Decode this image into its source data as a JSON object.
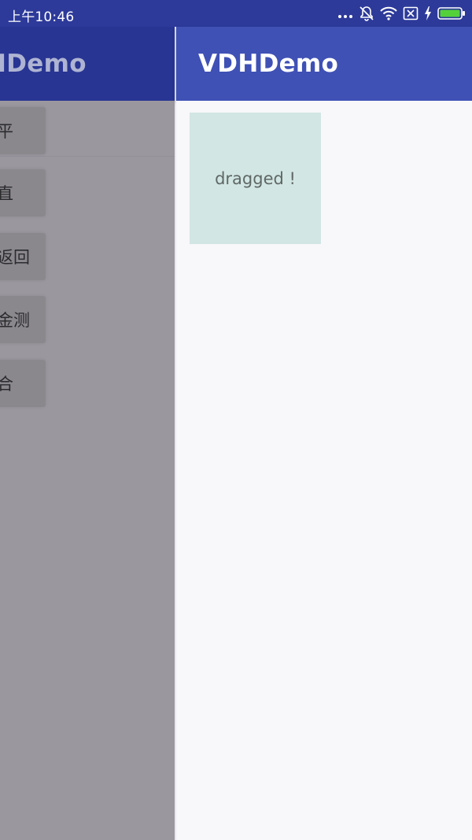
{
  "status_bar": {
    "time": "上午10:46",
    "icons": [
      "more-dots-icon",
      "notification-muted-icon",
      "wifi-icon",
      "no-sim-icon",
      "charging-bolt-icon",
      "battery-icon"
    ]
  },
  "app": {
    "title": "VDHDemo",
    "drag_box_label": "dragged !",
    "colors": {
      "primary": "#3f51b5",
      "primary_dark": "#2d3a9a",
      "box": "#d2e6e3"
    }
  },
  "ghost_pane": {
    "title": "HDemo",
    "buttons": [
      {
        "label": "平"
      },
      {
        "label": "直"
      },
      {
        "label": "返回"
      },
      {
        "label": "金测"
      },
      {
        "label": "合"
      }
    ]
  }
}
